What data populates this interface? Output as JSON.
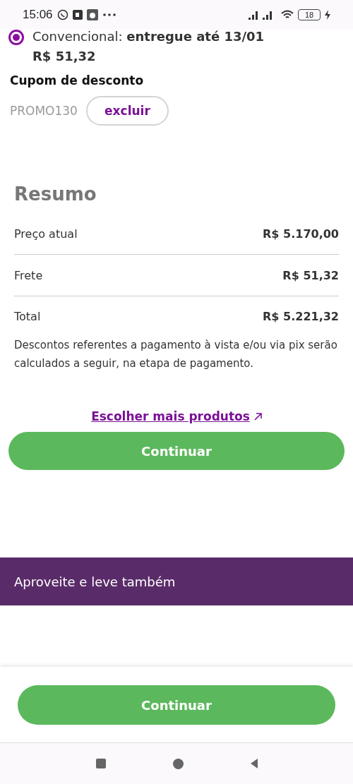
{
  "status_bar": {
    "time": "15:06",
    "battery": "18"
  },
  "shipping_option": {
    "label": "Convencional: **entregue até 13/01**",
    "price": "R$ 51,32",
    "selected": true
  },
  "coupon": {
    "title": "Cupom de desconto",
    "code": "PROMO130",
    "remove_button": "excluir"
  },
  "summary": {
    "title": "Resumo",
    "rows": [
      {
        "label": "Preço atual",
        "value": "R$ 5.170,00"
      },
      {
        "label": "Frete",
        "value": "R$ 51,32"
      },
      {
        "label": "Total",
        "value": "R$ 5.221,32"
      }
    ],
    "note": "Descontos referentes a pagamento à vista e/ou via pix serão calculados a seguir, na etapa de pagamento."
  },
  "more_products_link": "Escolher mais produtos",
  "continue_button": "Continuar",
  "upsell_banner": "Aproveite e leve também",
  "bottom_continue_button": "Continuar"
}
